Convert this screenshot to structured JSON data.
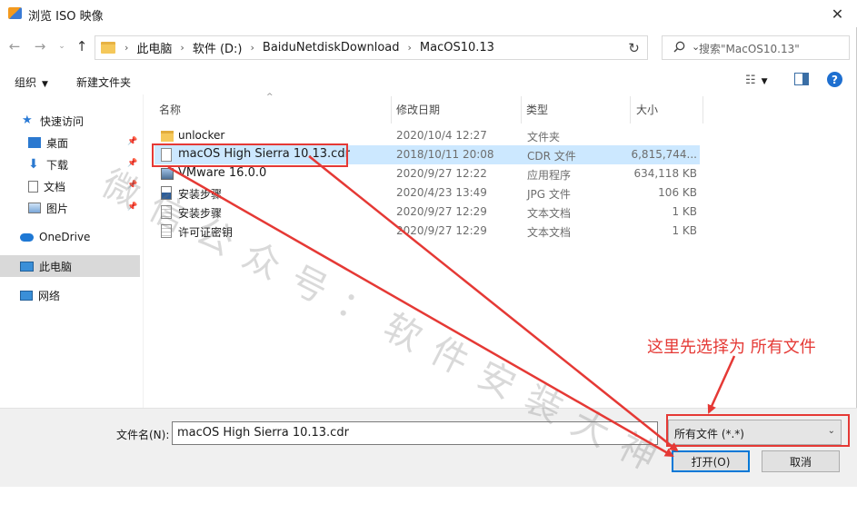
{
  "window": {
    "title": "浏览 ISO 映像"
  },
  "breadcrumbs": [
    "此电脑",
    "软件 (D:)",
    "BaiduNetdiskDownload",
    "MacOS10.13"
  ],
  "search": {
    "placeholder": "搜索\"MacOS10.13\""
  },
  "toolbar": {
    "organize": "组织",
    "new_folder": "新建文件夹"
  },
  "sidebar": {
    "quick_access": "快速访问",
    "desktop": "桌面",
    "downloads": "下载",
    "documents": "文档",
    "pictures": "图片",
    "onedrive": "OneDrive",
    "this_pc": "此电脑",
    "network": "网络"
  },
  "columns": {
    "name": "名称",
    "date": "修改日期",
    "type": "类型",
    "size": "大小"
  },
  "files": [
    {
      "name": "unlocker",
      "date": "2020/10/4 12:27",
      "type": "文件夹",
      "size": "",
      "icon": "folder-icon"
    },
    {
      "name": "macOS High Sierra 10.13.cdr",
      "date": "2018/10/11 20:08",
      "type": "CDR 文件",
      "size": "6,815,744...",
      "icon": "file-icon"
    },
    {
      "name": "VMware 16.0.0",
      "date": "2020/9/27 12:22",
      "type": "应用程序",
      "size": "634,118 KB",
      "icon": "app-icon"
    },
    {
      "name": "安装步骤",
      "date": "2020/4/23 13:49",
      "type": "JPG 文件",
      "size": "106 KB",
      "icon": "image-icon"
    },
    {
      "name": "安装步骤",
      "date": "2020/9/27 12:29",
      "type": "文本文档",
      "size": "1 KB",
      "icon": "text-file-icon"
    },
    {
      "name": "许可证密钥",
      "date": "2020/9/27 12:29",
      "type": "文本文档",
      "size": "1 KB",
      "icon": "text-file-icon"
    }
  ],
  "bottom": {
    "filename_label": "文件名(N):",
    "filename_value": "macOS High Sierra 10.13.cdr",
    "filter_value": "所有文件 (*.*)",
    "open_label": "打开(O)",
    "cancel_label": "取消"
  },
  "annotations": {
    "note": "这里先选择为 所有文件",
    "watermark": "微信公众号：软件安装大神",
    "color": "#e53935"
  }
}
